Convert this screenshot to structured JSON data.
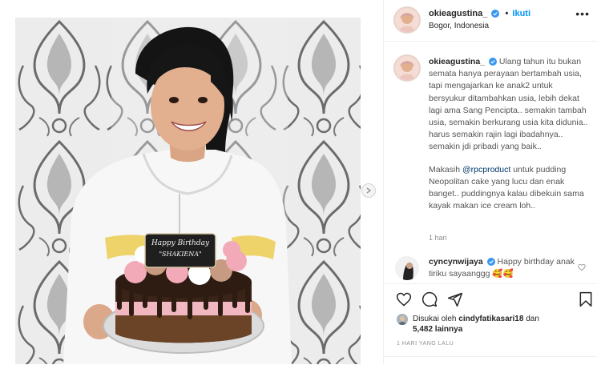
{
  "post": {
    "author": {
      "username": "okieagustina_",
      "verified": true,
      "follow_label": "Ikuti",
      "location": "Bogor, Indonesia"
    },
    "photo": {
      "cake_topper_line1": "Happy Birthday",
      "cake_topper_line2": "\"SHAKIENA\""
    },
    "caption": {
      "username": "okieagustina_",
      "text_part1": " Ulang tahun itu bukan semata hanya perayaan bertambah usia, tapi mengajarkan ke anak2 untuk bersyukur ditambahkan usia, lebih dekat lagi ama Sang Pencipta.. semakin tambah usia, semakin berkurang usia kita didunia.. harus semakin rajin lagi ibadahnya.. semakin jdi pribadi yang baik..",
      "text_part2_before": "Makasih ",
      "mention": "@rpcproduct",
      "text_part2_after": " untuk pudding Neopolitan cake yang lucu dan enak banget.. puddingnya kalau dibekuin sama kayak makan ice cream loh..",
      "time": "1 hari"
    },
    "comments": [
      {
        "username": "cyncynwijaya",
        "verified": true,
        "text": " Happy birthday anak tiriku sayaanggg 🥰🥰"
      }
    ],
    "likes": {
      "prefix": "Disukai oleh ",
      "first_user": "cindyfatikasari18",
      "conjunction": " dan",
      "others": "5,482 lainnya"
    },
    "timestamp": "1 HARI YANG LALU"
  },
  "icons": {
    "heart": "heart-icon",
    "comment": "comment-icon",
    "share": "paper-plane-icon",
    "save": "bookmark-icon",
    "more": "more-horizontal-icon",
    "next": "chevron-right-icon",
    "verified": "verified-badge-icon"
  },
  "colors": {
    "accent_blue": "#0095f6",
    "mention": "#00376b",
    "verified": "#3897f0"
  }
}
